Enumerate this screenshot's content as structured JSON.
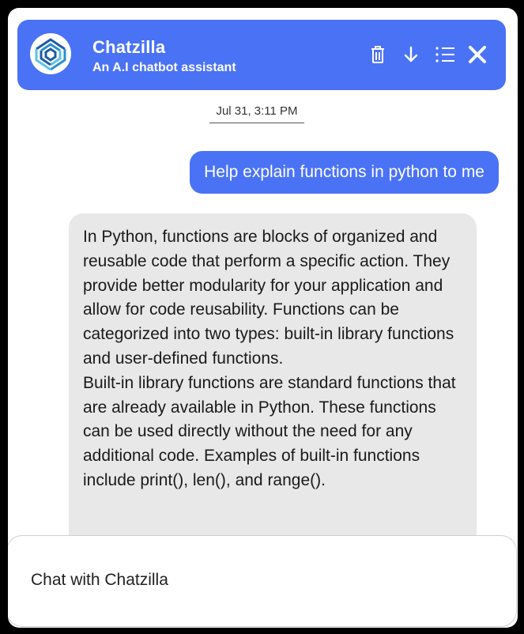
{
  "header": {
    "title": "Chatzilla",
    "subtitle": "An A.I chatbot assistant",
    "icons": [
      "trash-icon",
      "download-icon",
      "list-icon",
      "close-icon"
    ]
  },
  "conversation": {
    "timestamp": "Jul 31, 3:11 PM",
    "user_message": "Help explain functions in python to me",
    "bot_message": {
      "paragraph1": "In Python, functions are blocks of organized and reusable code that perform a specific action. They provide better modularity for your application and allow for code reusability. Functions can be categorized into two types: built-in library functions and user-defined functions.",
      "paragraph2": "Built-in library functions are standard functions that are already available in Python. These functions can be used directly without the need for any additional code. Examples of built-in functions include print(), len(), and range()."
    }
  },
  "composer": {
    "placeholder": "Chat with Chatzilla"
  },
  "colors": {
    "accent": "#4a72f5",
    "bot_bubble": "#e8e8e8",
    "backdrop": "#000000"
  }
}
